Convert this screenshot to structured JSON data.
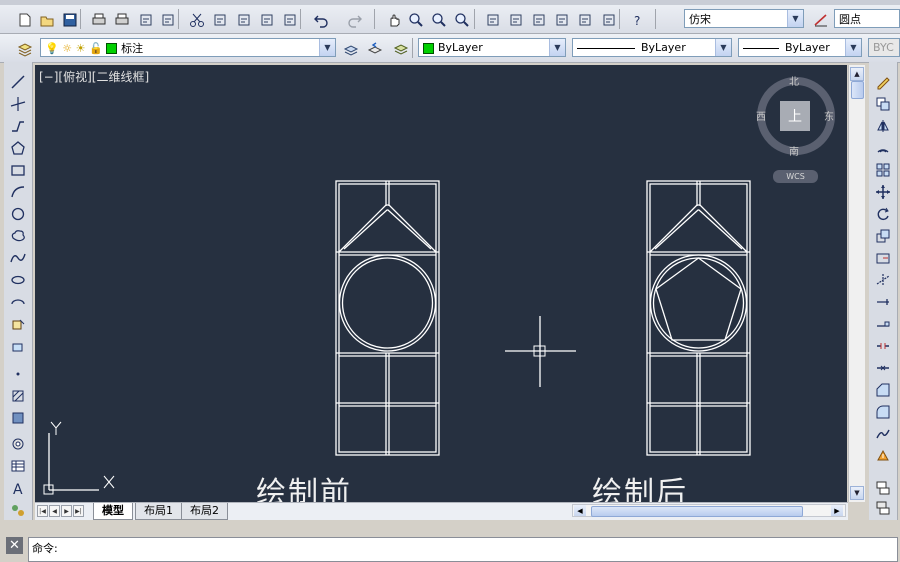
{
  "toolbar_top": {
    "font_combo": "仿宋",
    "dimstyle_combo": "圆点"
  },
  "toolbar_layers": {
    "layer_combo": "标注",
    "color_combo": "ByLayer",
    "linetype_combo": "ByLayer",
    "lineweight_combo": "ByLayer",
    "plotstyle_combo": "BYC"
  },
  "viewport": {
    "label": "[−][俯视][二维线框]",
    "caption_before": "绘制前",
    "caption_after": "绘制后"
  },
  "viewcube": {
    "north": "北",
    "south": "南",
    "east": "东",
    "west": "西",
    "top": "上",
    "wcs": "WCS"
  },
  "ucs": {
    "y": "Y",
    "x": "X"
  },
  "layout_tabs": [
    "模型",
    "布局1",
    "布局2"
  ],
  "command": {
    "prompt": "命令:"
  },
  "colors": {
    "canvas": "#263040",
    "lines": "#ffffff",
    "layer_swatch": "#00d000"
  },
  "icons": {
    "top_toolbar": [
      "new",
      "open",
      "save",
      "print",
      "print-preview",
      "publish",
      "3d-publish",
      "cut",
      "copy",
      "paste",
      "match-properties",
      "block-editor",
      "undo",
      "redo",
      "pan",
      "zoom-realtime",
      "zoom-window",
      "zoom-previous",
      "properties",
      "design-center",
      "tool-palettes",
      "sheet-set",
      "markup",
      "quickcalc",
      "help"
    ],
    "left_draw": [
      "line",
      "construction-line",
      "polyline",
      "polygon",
      "rectangle",
      "arc",
      "circle",
      "revision-cloud",
      "spline",
      "ellipse",
      "ellipse-arc",
      "insert-block",
      "make-block",
      "point",
      "hatch",
      "gradient",
      "region",
      "table",
      "multiline-text",
      "add-selected"
    ],
    "right_modify": [
      "erase",
      "copy-object",
      "mirror",
      "offset",
      "array",
      "move",
      "rotate",
      "scale",
      "stretch",
      "trim",
      "extend",
      "break-at-point",
      "break",
      "join",
      "chamfer",
      "fillet",
      "blend-curves",
      "explode"
    ]
  }
}
